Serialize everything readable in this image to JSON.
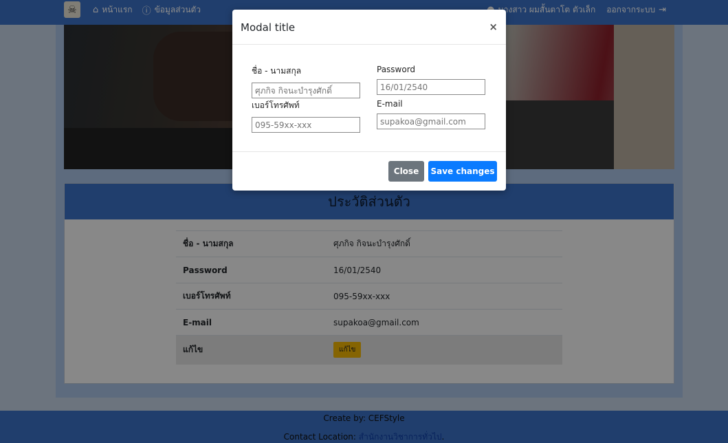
{
  "nav": {
    "logo_icon": "skull-logo",
    "home_label": "หน้าแรก",
    "profile_label": "ข้อมูลส่วนตัว",
    "user_label": "นางสาว ผมสั้นตาโต ตัวเล็ก",
    "logout_label": "ออกจากระบบ"
  },
  "card": {
    "title": "ประวัติส่วนตัว",
    "rows": [
      {
        "key": "ชื่อ - นามสกุล",
        "value": "ศุภกิจ กิจนะบำรุงศักดิ์"
      },
      {
        "key": "Password",
        "value": "16/01/2540"
      },
      {
        "key": "เบอร์โทรศัพท์",
        "value": "095-59xx-xxx"
      },
      {
        "key": "E-mail",
        "value": "supakoa@gmail.com"
      }
    ],
    "edit_row_label": "แก้ไข",
    "edit_button": "แก้ไข"
  },
  "footer": {
    "created_by": "Create by: CEFStyle",
    "contact_prefix": "Contact Location:",
    "contact_link": "สำนักงานวิชาการทั่วไป"
  },
  "modal": {
    "title": "Modal title",
    "close_x": "×",
    "fields": {
      "name_label": "ชื่อ - นามสกุล",
      "name_value": "ศุภกิจ กิจนะบำรุงศักดิ์",
      "password_label": "Password",
      "password_value": "16/01/2540",
      "phone_label": "เบอร์โทรศัพท์",
      "phone_value": "095-59xx-xxx",
      "email_label": "E-mail",
      "email_value": "supakoa@gmail.com"
    },
    "close_button": "Close",
    "save_button": "Save changes"
  },
  "colors": {
    "navbar": "#3b71c6",
    "primary_button": "#0a7bff",
    "secondary_button": "#6c757d",
    "warning_button": "#f2b705"
  }
}
